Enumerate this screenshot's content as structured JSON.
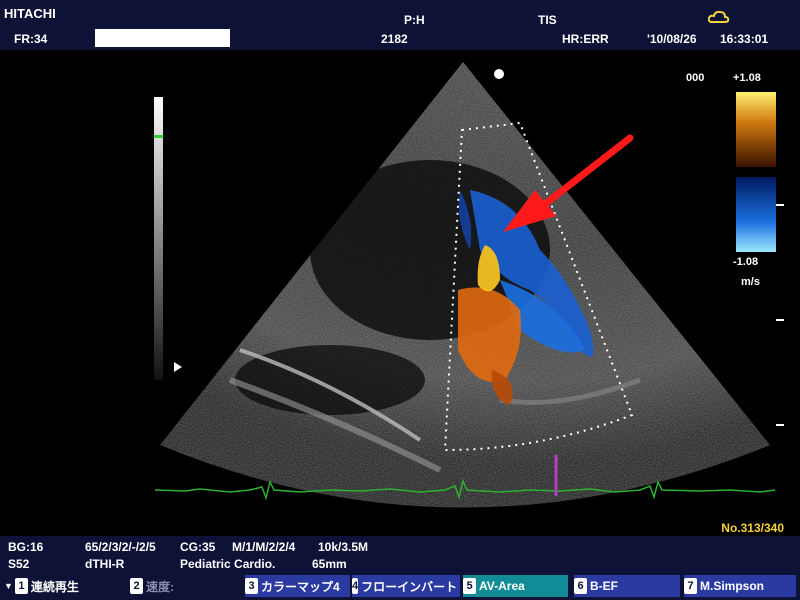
{
  "header": {
    "brand": "HITACHI",
    "frame_rate": "FR:34",
    "probe": "P:H",
    "tis": "TIS",
    "depth_code": "2182",
    "heart_rate": "HR:ERR",
    "date": "'10/08/26",
    "time": "16:33:01",
    "status_icon": "cloud-icon"
  },
  "velocity_scale": {
    "mode": "000",
    "max": "+1.08",
    "min": "-1.08",
    "unit": "m/s"
  },
  "image_counter": "No.313/340",
  "info": {
    "bg": "BG:16",
    "bg_params": "65/2/3/2/-/2/5",
    "cg": "CG:35",
    "cg_params": "M/1/M/2/2/4",
    "freq": "10k/3.5M",
    "preset": "S52",
    "mode": "dTHI-R",
    "app": "Pediatric Cardio.",
    "depth": "65mm"
  },
  "function_keys": [
    {
      "num": "1",
      "label": "連続再生"
    },
    {
      "num": "2",
      "label": "速度:"
    },
    {
      "num": "3",
      "label": "カラーマップ4"
    },
    {
      "num": "4",
      "label": "フローインバート"
    },
    {
      "num": "5",
      "label": "AV-Area"
    },
    {
      "num": "6",
      "label": "B-EF"
    },
    {
      "num": "7",
      "label": "M.Simpson"
    }
  ],
  "colors": {
    "panel_bg": "#0d1236",
    "doppler_positive": "#e06a10",
    "doppler_negative": "#1a6fe0",
    "ecg": "#2fb02f",
    "annotation_arrow": "#ff1a1a",
    "counter": "#f4d23c"
  }
}
